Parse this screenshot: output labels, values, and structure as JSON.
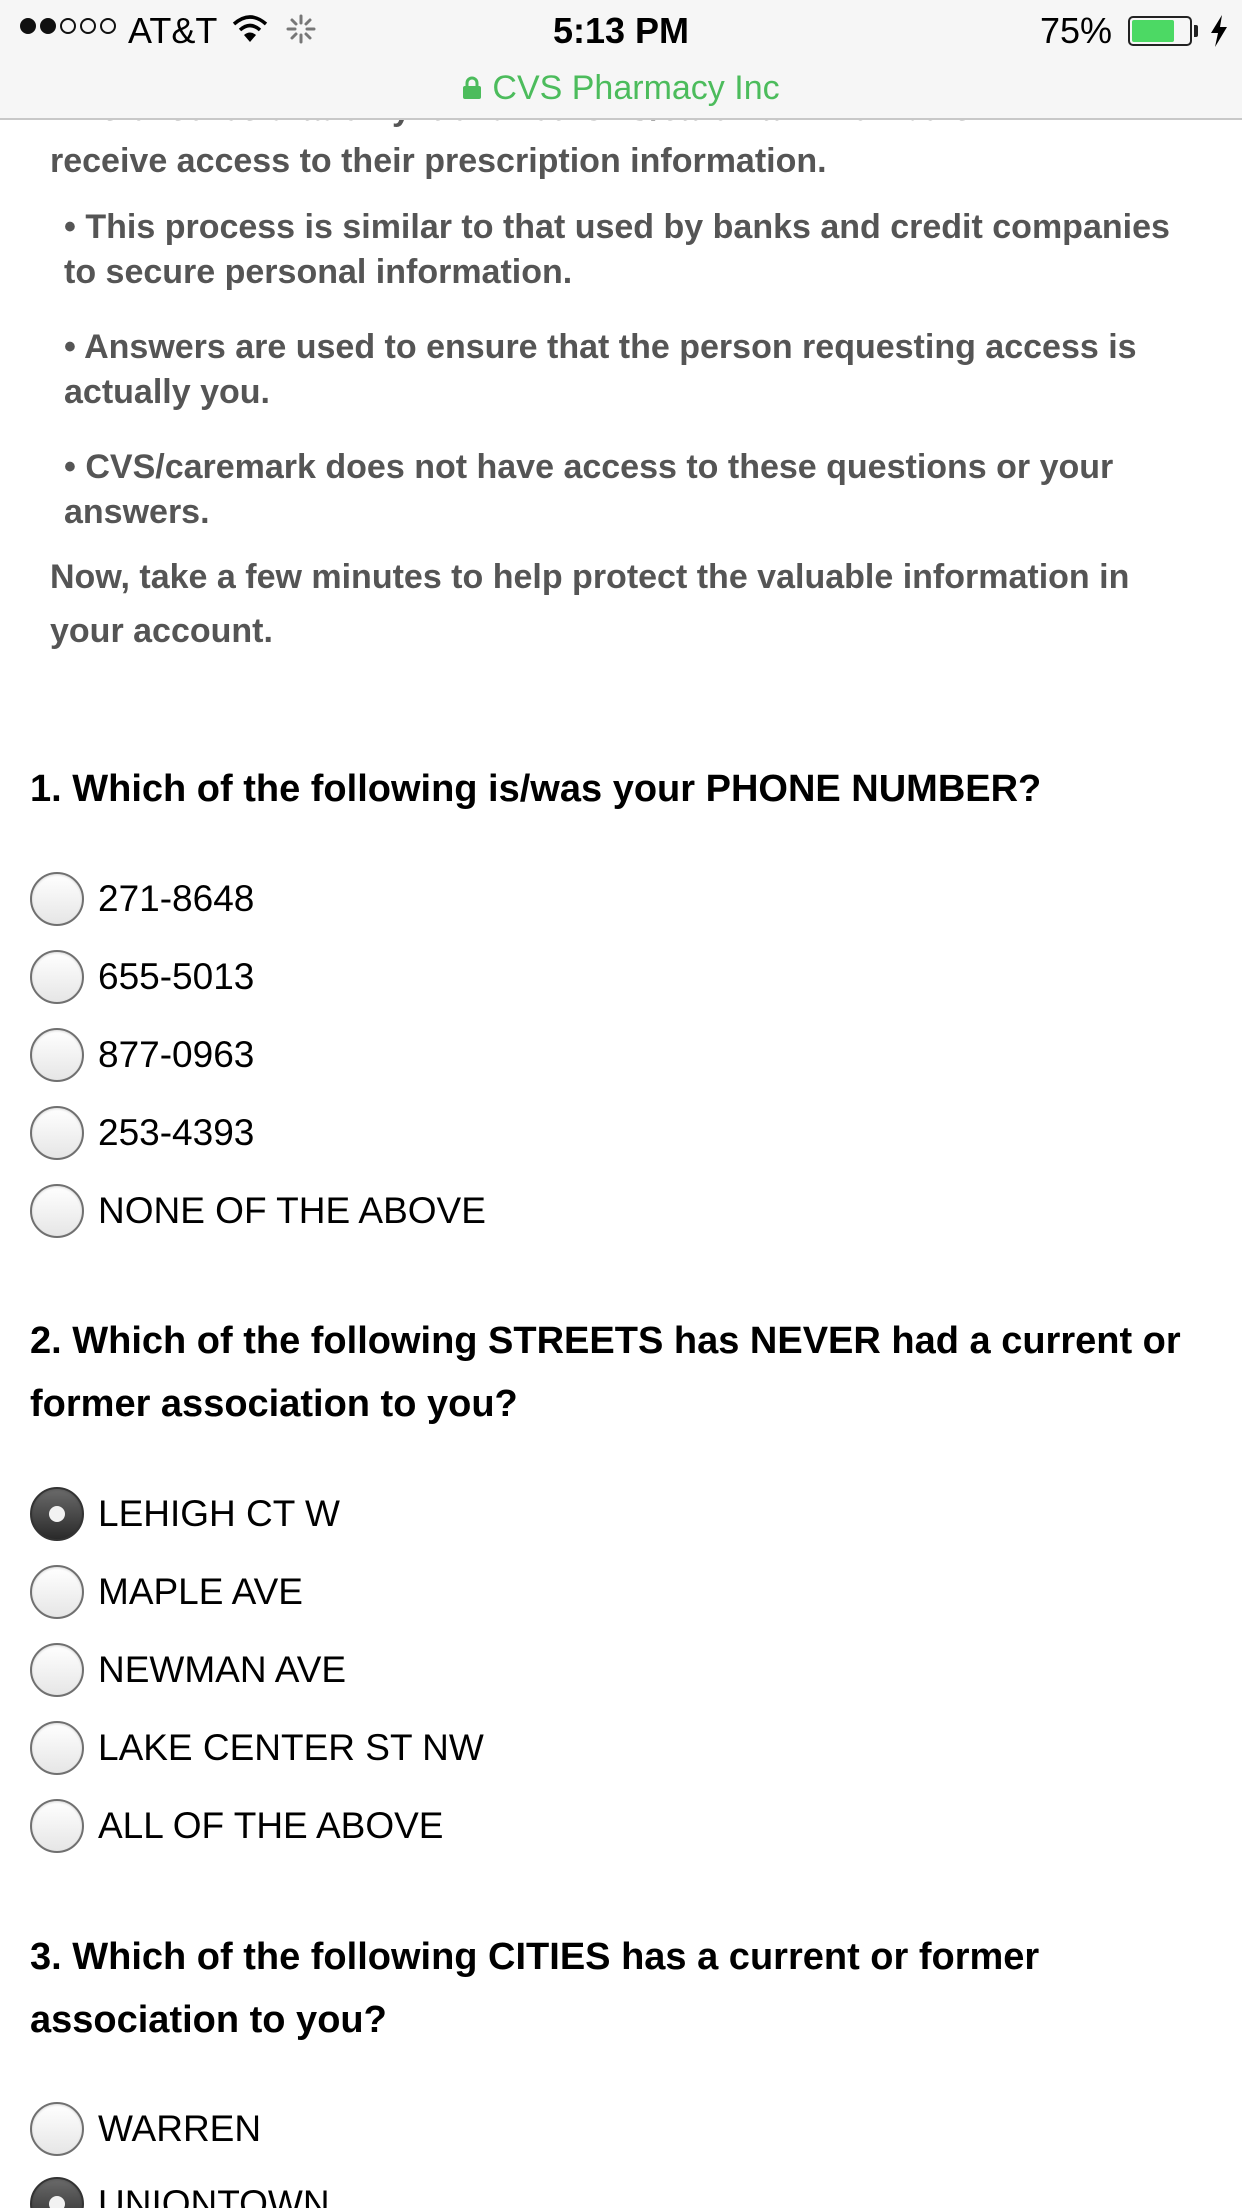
{
  "status_bar": {
    "carrier": "AT&T",
    "time": "5:13 PM",
    "battery_percent": "75%",
    "battery_level": 0.75,
    "signal_icon": "signal-dots-icon",
    "wifi_icon": "wifi-icon",
    "activity_icon": "activity-spinner-icon",
    "charging_icon": "charging-bolt-icon"
  },
  "url_bar": {
    "site_name": "CVS Pharmacy Inc",
    "lock_icon": "lock-icon",
    "color": "#4cbc5c"
  },
  "intro": {
    "cut_line": "This ensures that only identified CVS/caremark members",
    "paragraph_1": "receive access to their prescription information.",
    "bullets": [
      "• This process is similar to that used by banks and credit companies to secure personal information.",
      "• Answers are used to ensure that the person requesting access is actually you.",
      "• CVS/caremark does not have access to these questions or your answers."
    ],
    "paragraph_2": "Now, take a few minutes to help protect the valuable information in your account."
  },
  "questions": [
    {
      "text": "1. Which of the following is/was your PHONE NUMBER?",
      "options": [
        "271-8648",
        "655-5013",
        "877-0963",
        "253-4393",
        "NONE OF THE ABOVE"
      ],
      "selected_index": null
    },
    {
      "text": "2. Which of the following STREETS has NEVER had a current or former association to you?",
      "options": [
        "LEHIGH CT W",
        "MAPLE AVE",
        "NEWMAN AVE",
        "LAKE CENTER ST NW",
        "ALL OF THE ABOVE"
      ],
      "selected_index": 0
    },
    {
      "text": "3. Which of the following CITIES has a current or former association to you?",
      "options": [
        "WARREN",
        "UNIONTOWN"
      ],
      "selected_index": 1
    }
  ]
}
